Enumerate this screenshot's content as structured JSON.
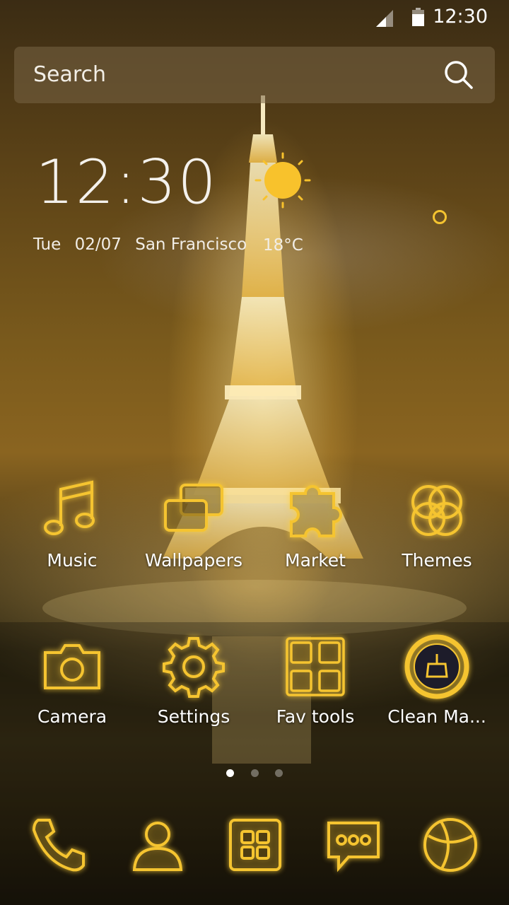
{
  "status_bar": {
    "time": "12:30"
  },
  "search": {
    "placeholder": "Search"
  },
  "clock_widget": {
    "time": "12:30",
    "day": "Tue",
    "date": "02/07",
    "city": "San Francisco",
    "temperature": "18°C",
    "weather_icon": "sun-icon"
  },
  "apps": [
    {
      "label": "Music",
      "icon": "music-note-icon"
    },
    {
      "label": "Wallpapers",
      "icon": "wallpapers-icon"
    },
    {
      "label": "Market",
      "icon": "puzzle-icon"
    },
    {
      "label": "Themes",
      "icon": "themes-icon"
    },
    {
      "label": "Camera",
      "icon": "camera-icon"
    },
    {
      "label": "Settings",
      "icon": "gear-icon"
    },
    {
      "label": "Fav tools",
      "icon": "fav-tools-icon"
    },
    {
      "label": "Clean Ma...",
      "icon": "broom-icon"
    }
  ],
  "page_indicator": {
    "pages": 3,
    "current": 1
  },
  "dock": [
    {
      "icon": "phone-icon"
    },
    {
      "icon": "contacts-icon"
    },
    {
      "icon": "app-drawer-icon"
    },
    {
      "icon": "messages-icon"
    },
    {
      "icon": "browser-icon"
    }
  ],
  "colors": {
    "accent_gold": "#f5c430",
    "sun": "#f8c22c"
  }
}
